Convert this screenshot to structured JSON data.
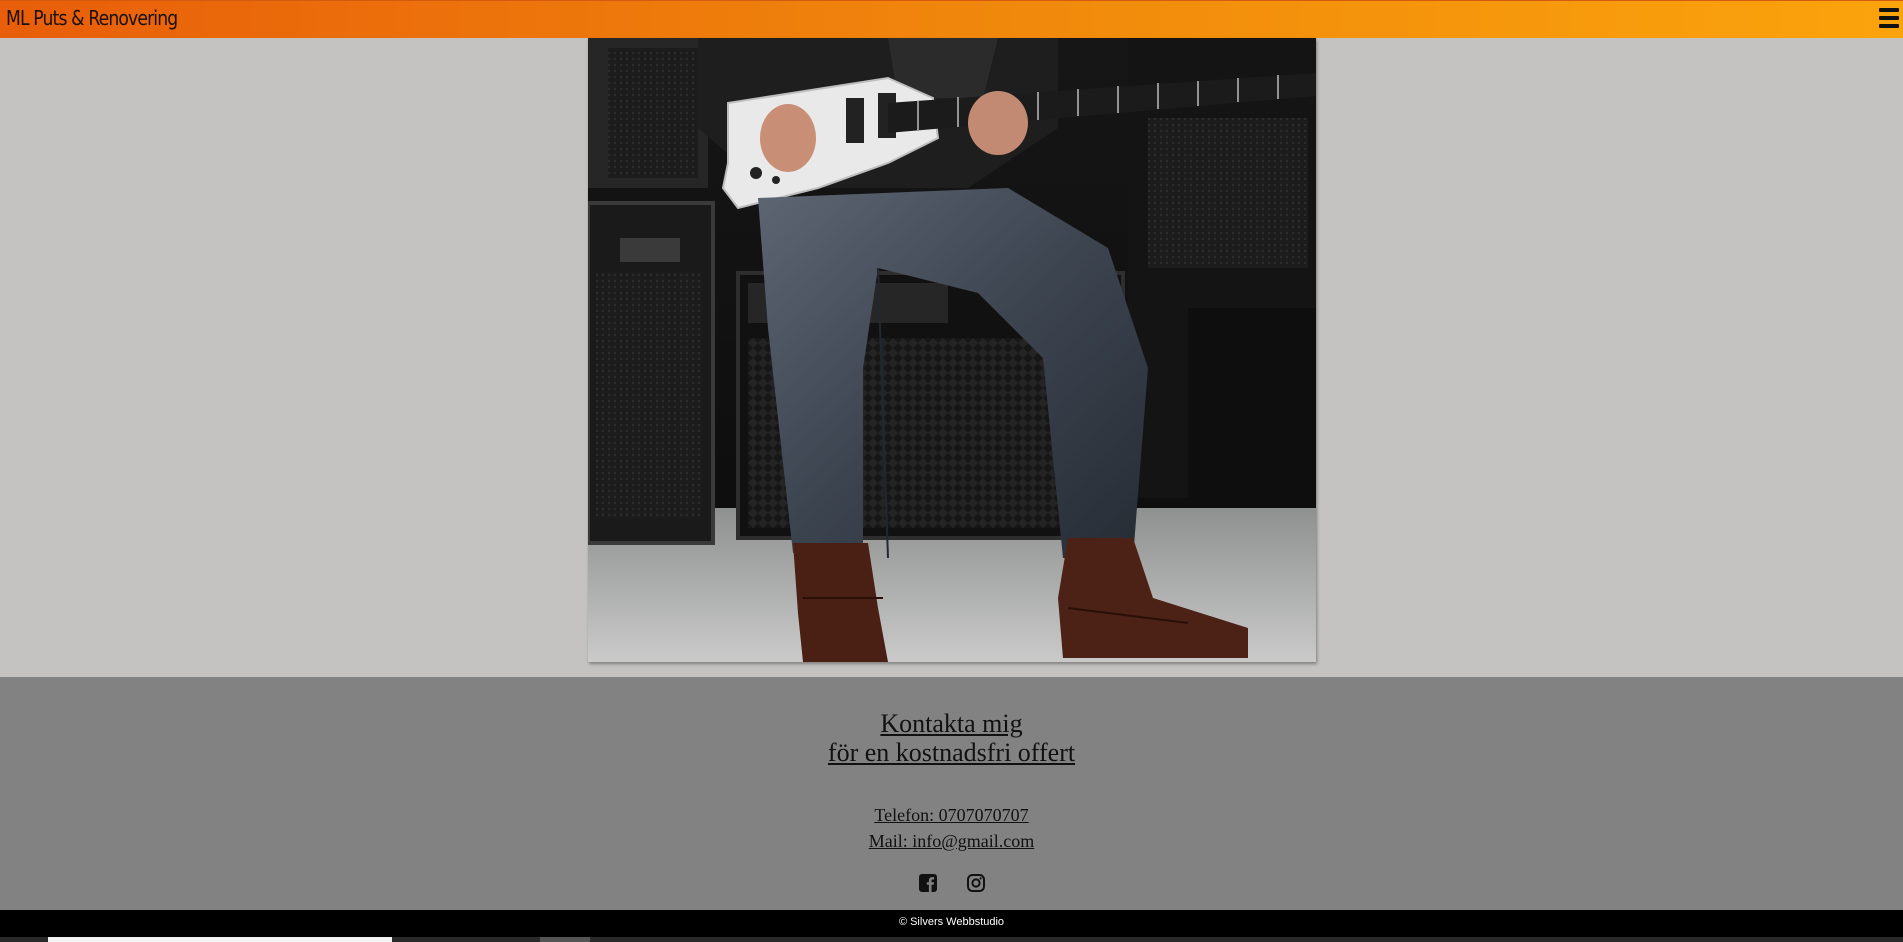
{
  "header": {
    "brand": "ML Puts & Renovering",
    "menu_icon": "hamburger-menu-icon",
    "gradient_colors": [
      "#e85e0a",
      "#fba30c"
    ]
  },
  "hero": {
    "image": "guitarist-seated-on-amplifiers-photo"
  },
  "footer": {
    "cta_line1": "Kontakta mig",
    "cta_line2": "för en kostnadsfri offert",
    "phone": "Telefon: 0707070707",
    "mail": "Mail: info@gmail.com",
    "social_icons": [
      "facebook-icon",
      "instagram-icon"
    ],
    "background": "#828282"
  },
  "bottom_bar": {
    "copyright": "© Silvers Webbstudio"
  }
}
